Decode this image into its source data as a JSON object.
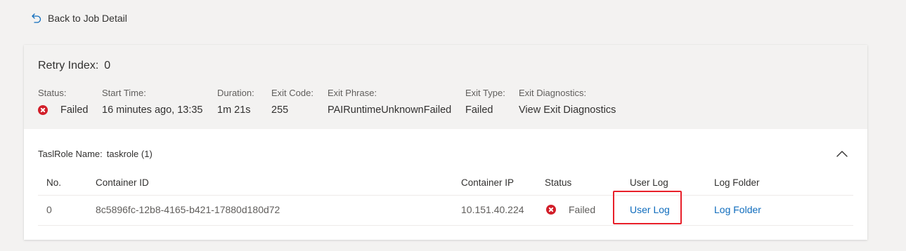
{
  "nav": {
    "back_label": "Back to Job Detail"
  },
  "summary": {
    "retry_label": "Retry Index:",
    "retry_value": "0",
    "fields": {
      "status": {
        "label": "Status:",
        "value": "Failed"
      },
      "start_time": {
        "label": "Start Time:",
        "value": "16 minutes ago, 13:35"
      },
      "duration": {
        "label": "Duration:",
        "value": "1m 21s"
      },
      "exit_code": {
        "label": "Exit Code:",
        "value": "255"
      },
      "exit_phrase": {
        "label": "Exit Phrase:",
        "value": "PAIRuntimeUnknownFailed"
      },
      "exit_type": {
        "label": "Exit Type:",
        "value": "Failed"
      },
      "exit_diagnostics": {
        "label": "Exit Diagnostics:",
        "value": "View Exit Diagnostics"
      }
    }
  },
  "task_role": {
    "label": "TaslRole Name:",
    "value": "taskrole (1)",
    "icon": "chevron-up-icon"
  },
  "table": {
    "headers": {
      "no": "No.",
      "container_id": "Container ID",
      "container_ip": "Container IP",
      "status": "Status",
      "user_log": "User Log",
      "log_folder": "Log Folder"
    },
    "rows": [
      {
        "no": "0",
        "container_id": "8c5896fc-12b8-4165-b421-17880d180d72",
        "container_ip": "10.151.40.224",
        "status": "Failed",
        "user_log": "User Log",
        "log_folder": "Log Folder"
      }
    ]
  },
  "colors": {
    "accent": "#0f6cbd",
    "error": "#d21f2a",
    "highlight": "#e8202a",
    "background": "#f3f2f1"
  }
}
